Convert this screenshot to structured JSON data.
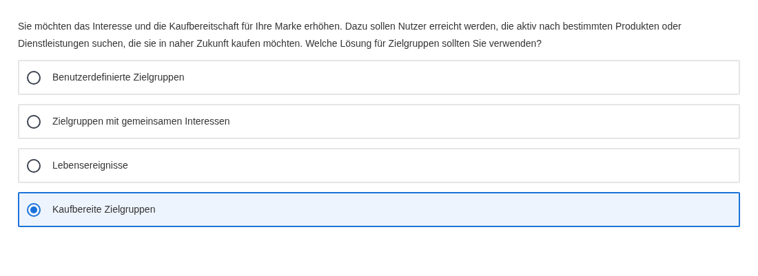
{
  "question": "Sie möchten das Interesse und die Kaufbereitschaft für Ihre Marke erhöhen. Dazu sollen Nutzer erreicht werden, die aktiv nach bestimmten Produkten oder Dienstleistungen suchen, die sie in naher Zukunft kaufen möchten. Welche Lösung für Zielgruppen sollten Sie verwenden?",
  "options": [
    {
      "label": "Benutzerdefinierte Zielgruppen",
      "selected": false
    },
    {
      "label": "Zielgruppen mit gemeinsamen Interessen",
      "selected": false
    },
    {
      "label": "Lebensereignisse",
      "selected": false
    },
    {
      "label": "Kaufbereite Zielgruppen",
      "selected": true
    }
  ]
}
